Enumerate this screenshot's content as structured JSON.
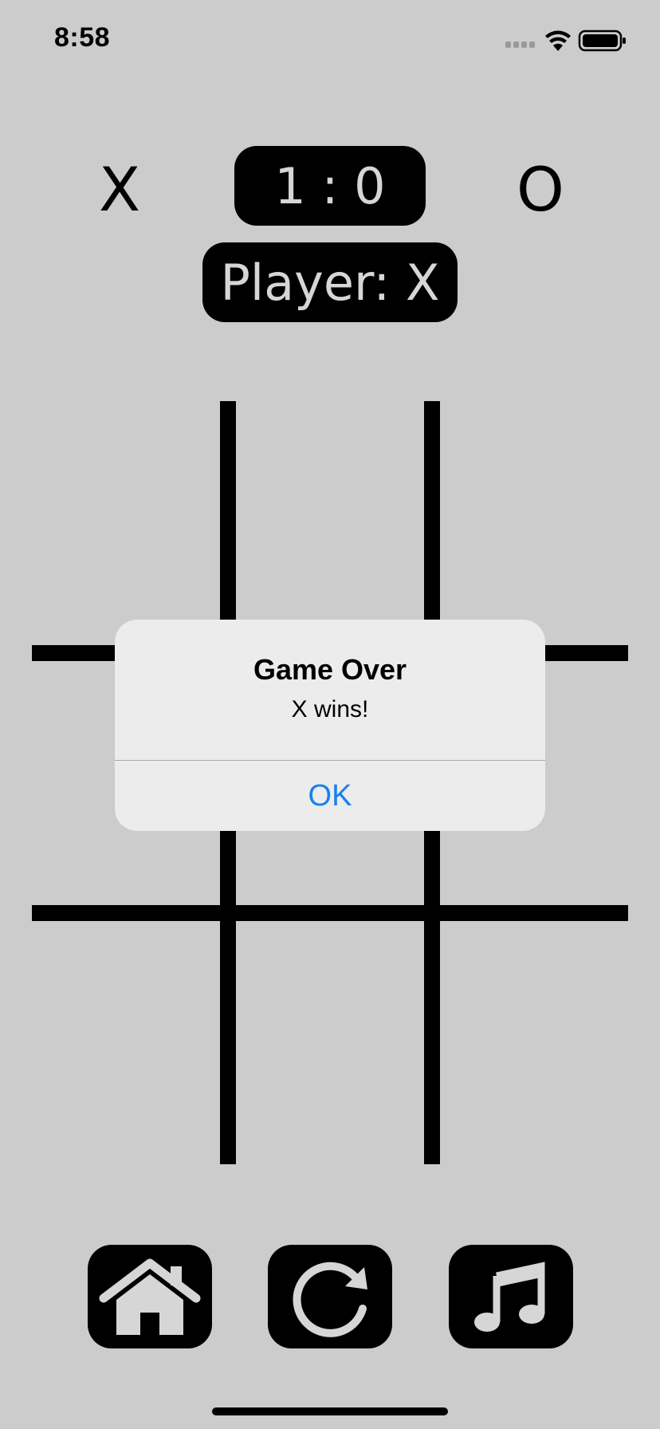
{
  "status_bar": {
    "time": "8:58",
    "icons": [
      "cellular-signal-icon",
      "wifi-icon",
      "battery-icon"
    ]
  },
  "scoreboard": {
    "player_x": "X",
    "player_o": "O",
    "score": "1 : 0",
    "turn": "Player: X"
  },
  "board": {
    "cells": [
      "",
      "",
      "",
      "",
      "",
      "",
      "",
      "",
      ""
    ]
  },
  "alert": {
    "title": "Game Over",
    "message": "X wins!",
    "ok_label": "OK"
  },
  "toolbar": {
    "buttons": [
      {
        "name": "home",
        "icon": "home-icon"
      },
      {
        "name": "restart",
        "icon": "restart-icon"
      },
      {
        "name": "music",
        "icon": "music-note-icon"
      }
    ]
  },
  "colors": {
    "background": "#cccccc",
    "pill_background": "#000000",
    "pill_text": "#d6d6d6",
    "alert_background": "#ececec",
    "alert_button": "#1a7ff0"
  }
}
